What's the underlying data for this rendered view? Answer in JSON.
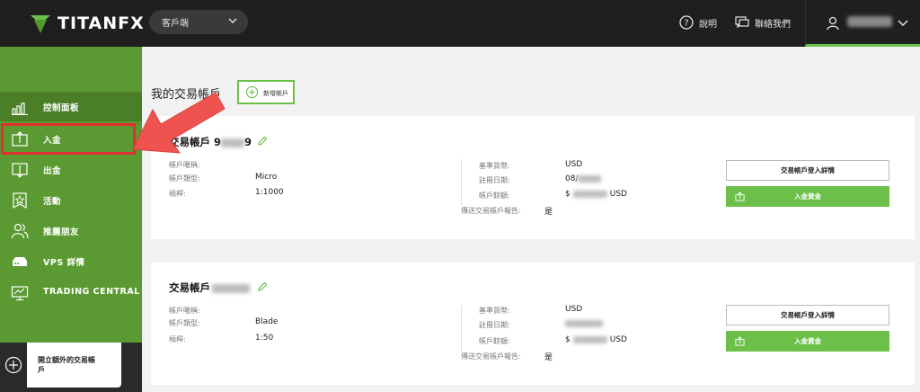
{
  "header": {
    "logo_text": "TITANFX",
    "portal": "客戶端",
    "help": "說明",
    "contact": "聯絡我們"
  },
  "sidebar": {
    "items": [
      {
        "label": "控制面板",
        "icon": "bar-chart-icon"
      },
      {
        "label": "入金",
        "icon": "deposit-icon"
      },
      {
        "label": "出金",
        "icon": "withdraw-icon"
      },
      {
        "label": "活動",
        "icon": "star-badge-icon"
      },
      {
        "label": "推薦朋友",
        "icon": "users-icon"
      },
      {
        "label": "VPS 詳情",
        "icon": "server-icon"
      },
      {
        "label": "TRADING CENTRAL",
        "icon": "monitor-chart-icon"
      }
    ],
    "open_extra": "開立額外的交易帳戶"
  },
  "main": {
    "title": "我的交易帳戶",
    "new_account": "新增帳戶",
    "labels": {
      "nickname": "帳戶暱稱:",
      "type": "帳戶類型:",
      "leverage": "槓桿:",
      "base_currency": "基準貨幣:",
      "reg_date": "註冊日期:",
      "balance": "帳戶餘額:",
      "send_report": "傳送交易帳戶報告:"
    },
    "accounts": [
      {
        "title_prefix": "交易帳戶 9",
        "title_suffix": "9",
        "type": "Micro",
        "leverage": "1:1000",
        "currency": "USD",
        "reg_date": "08/",
        "balance_prefix": "$",
        "balance_suffix": "USD",
        "report": "是",
        "login_btn": "交易帳戶登入詳情",
        "deposit_btn": "入金資金"
      },
      {
        "title_prefix": "交易帳戶",
        "title_suffix": "",
        "type": "Blade",
        "leverage": "1:50",
        "currency": "USD",
        "reg_date": "",
        "balance_prefix": "$",
        "balance_suffix": "USD",
        "report": "是",
        "login_btn": "交易帳戶登入詳情",
        "deposit_btn": "入金資金"
      }
    ]
  },
  "colors": {
    "topbar": "#1f1f1f",
    "sidebar": "#5b9a32",
    "accent_green": "#6cc04a",
    "annotation_red": "#e23030",
    "annotation_arrow": "#ef5350"
  }
}
